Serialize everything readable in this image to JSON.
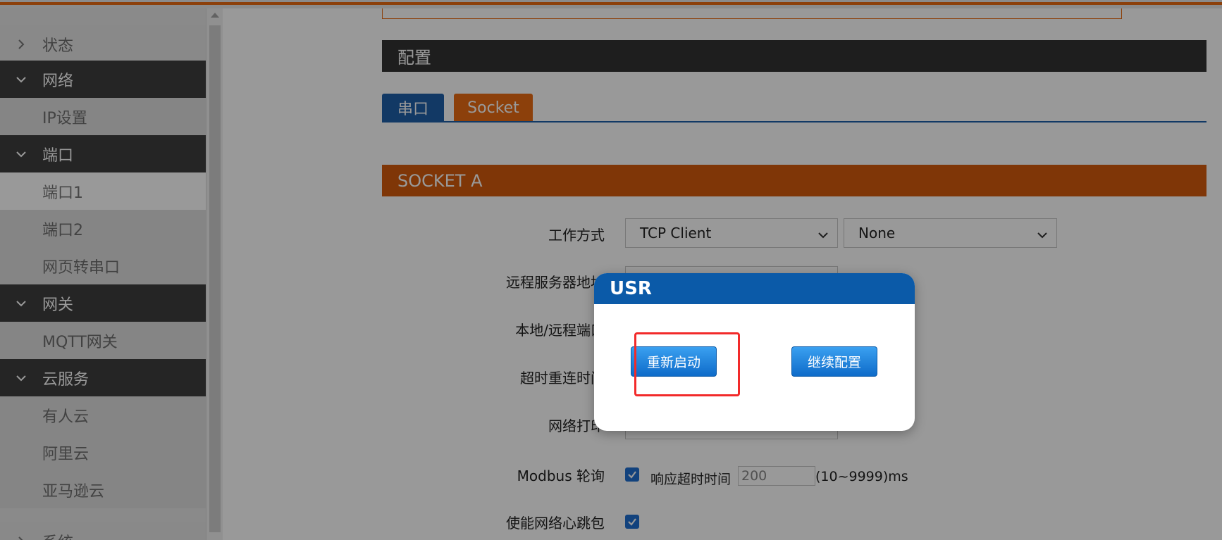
{
  "sidebar": {
    "items": [
      {
        "label": "状态",
        "kind": "collapsed"
      },
      {
        "label": "网络",
        "kind": "group"
      },
      {
        "label": "IP设置",
        "kind": "child"
      },
      {
        "label": "端口",
        "kind": "group"
      },
      {
        "label": "端口1",
        "kind": "child-active"
      },
      {
        "label": "端口2",
        "kind": "child"
      },
      {
        "label": "网页转串口",
        "kind": "child"
      },
      {
        "label": "网关",
        "kind": "group"
      },
      {
        "label": "MQTT网关",
        "kind": "child"
      },
      {
        "label": "云服务",
        "kind": "group"
      },
      {
        "label": "有人云",
        "kind": "child"
      },
      {
        "label": "阿里云",
        "kind": "child"
      },
      {
        "label": "亚马逊云",
        "kind": "child"
      },
      {
        "label": "系统",
        "kind": "collapsed"
      }
    ]
  },
  "main": {
    "config_header": "配置",
    "tabs": [
      {
        "label": "串口"
      },
      {
        "label": "Socket"
      }
    ],
    "socket_header": "SOCKET A",
    "form": {
      "work_mode_label": "工作方式",
      "work_mode_value": "TCP Client",
      "work_mode_sub_value": "None",
      "remote_server_label": "远程服务器地址",
      "port_label": "本地/远程端口",
      "reconnect_label": "超时重连时间",
      "net_print_label": "网络打印",
      "modbus_label": "Modbus 轮询",
      "modbus_checked": true,
      "response_timeout_label": "响应超时时间",
      "response_timeout_value": "200",
      "response_timeout_range": "(10~9999)ms",
      "heartbeat_label": "使能网络心跳包",
      "heartbeat_checked": true
    }
  },
  "dialog": {
    "title": "USR",
    "restart_label": "重新启动",
    "continue_label": "继续配置"
  },
  "colors": {
    "accent_orange": "#ea6b13",
    "accent_blue": "#1f5fa8",
    "highlight_red": "#f22a2a"
  }
}
